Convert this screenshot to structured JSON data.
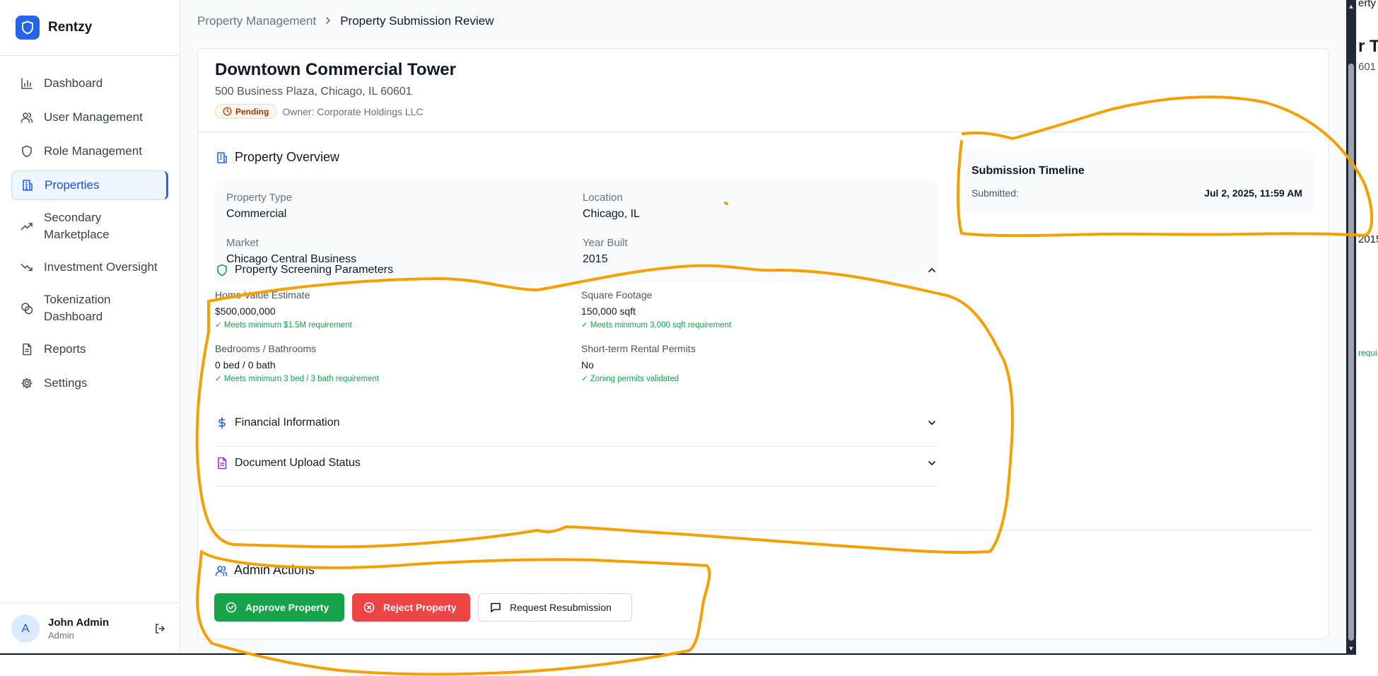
{
  "brand": {
    "name": "Rentzy"
  },
  "sidebar": {
    "items": [
      {
        "label": "Dashboard",
        "icon": "bar-chart-icon"
      },
      {
        "label": "User Management",
        "icon": "users-icon"
      },
      {
        "label": "Role Management",
        "icon": "shield-icon"
      },
      {
        "label": "Properties",
        "icon": "building-icon",
        "active": true
      },
      {
        "label": "Secondary Marketplace",
        "icon": "trending-up-icon"
      },
      {
        "label": "Investment Oversight",
        "icon": "trending-down-icon"
      },
      {
        "label": "Tokenization Dashboard",
        "icon": "coins-icon"
      },
      {
        "label": "Reports",
        "icon": "file-icon"
      },
      {
        "label": "Settings",
        "icon": "gear-icon"
      }
    ],
    "user": {
      "initial": "A",
      "name": "John Admin",
      "role": "Admin"
    }
  },
  "breadcrumb": {
    "parent": "Property Management",
    "current": "Property Submission Review"
  },
  "property": {
    "title": "Downtown Commercial Tower",
    "address": "500 Business Plaza, Chicago, IL 60601",
    "status": "Pending",
    "owner": "Owner: Corporate Holdings LLC"
  },
  "overview": {
    "title": "Property Overview",
    "fields": {
      "type_label": "Property Type",
      "type_value": "Commercial",
      "location_label": "Location",
      "location_value": "Chicago, IL",
      "market_label": "Market",
      "market_value": "Chicago Central Business",
      "year_label": "Year Built",
      "year_value": "2015"
    }
  },
  "timeline": {
    "title": "Submission Timeline",
    "submitted_label": "Submitted:",
    "submitted_value": "Jul 2, 2025, 11:59 AM"
  },
  "screening": {
    "title": "Property Screening Parameters",
    "home_value_label": "Home Value Estimate",
    "home_value": "$500,000,000",
    "home_value_check": "✓ Meets minimum $1.5M requirement",
    "sqft_label": "Square Footage",
    "sqft_value": "150,000 sqft",
    "sqft_check": "✓ Meets minimum 3,000 sqft requirement",
    "bedbath_label": "Bedrooms / Bathrooms",
    "bedbath_value": "0 bed / 0 bath",
    "bedbath_check": "✓ Meets minimum 3 bed / 3 bath requirement",
    "str_label": "Short-term Rental Permits",
    "str_value": "No",
    "str_check": "✓ Zoning permits validated"
  },
  "financial": {
    "title": "Financial Information"
  },
  "documents": {
    "title": "Document Upload Status"
  },
  "admin": {
    "title": "Admin Actions",
    "approve_label": "Approve Property",
    "reject_label": "Reject Property",
    "resubmit_label": "Request Resubmission"
  },
  "fragment": {
    "text_a": "erty",
    "text_b": "r To",
    "text_c": "601",
    "text_d": "2015",
    "text_e": "requi"
  },
  "colors": {
    "accent": "#2563eb",
    "annotation": "#f5a000",
    "approve": "#16a34a",
    "reject": "#ef4444"
  }
}
